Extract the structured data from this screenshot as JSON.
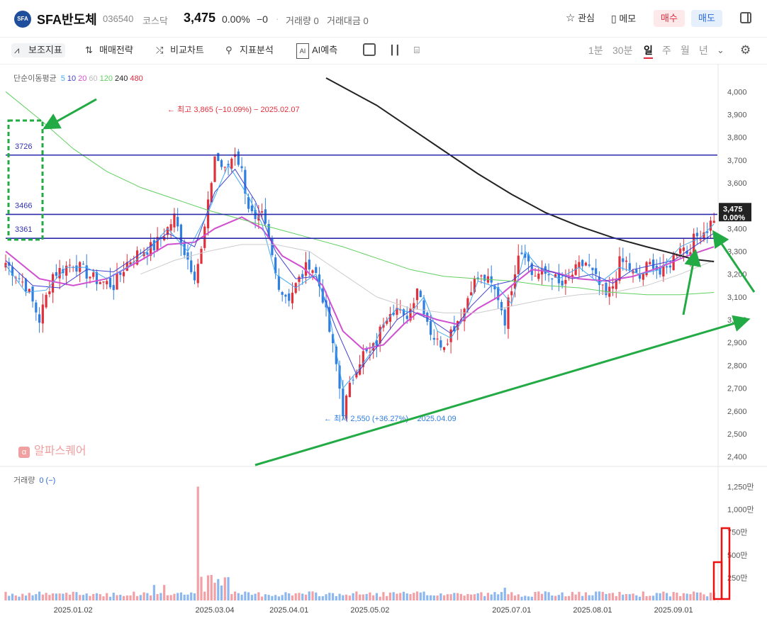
{
  "header": {
    "logo": "SFA",
    "name": "SFA반도체",
    "code": "036540",
    "market": "코스닥",
    "price": "3,475",
    "change_pct": "0.00%",
    "change": "−0",
    "volume": "거래량 0",
    "amount": "거래대금 0",
    "watch_label": "관심",
    "memo_label": "메모",
    "buy_label": "매수",
    "sell_label": "매도"
  },
  "toolbar": {
    "indicators": "보조지표",
    "strategy": "매매전략",
    "compare": "비교차트",
    "analysis": "지표분석",
    "ai": "AI예측",
    "timeframes": [
      "1분",
      "30분",
      "일",
      "주",
      "월",
      "년"
    ],
    "active_timeframe": "일"
  },
  "legend": {
    "ma_title": "단순이동평균",
    "ma_periods": [
      {
        "label": "5",
        "color": "#3fa9f5"
      },
      {
        "label": "10",
        "color": "#4040d0"
      },
      {
        "label": "20",
        "color": "#d050d0"
      },
      {
        "label": "60",
        "color": "#bbbbbb"
      },
      {
        "label": "120",
        "color": "#60d060"
      },
      {
        "label": "240",
        "color": "#222222"
      },
      {
        "label": "480",
        "color": "#e02b3f"
      }
    ],
    "volume_title": "거래량",
    "volume_value": "0 (−)"
  },
  "watermark": "알파스퀘어",
  "chart_data": {
    "type": "candlestick",
    "price_axis": {
      "ticks": [
        "4,000",
        "3,900",
        "3,800",
        "3,700",
        "3,600",
        "3,500",
        "3,400",
        "3,300",
        "3,200",
        "3,100",
        "3,000",
        "2,900",
        "2,800",
        "2,700",
        "2,600",
        "2,500",
        "2,400"
      ],
      "range": [
        2360,
        4060
      ]
    },
    "volume_axis": {
      "ticks": [
        "1,250만",
        "1,000만",
        "750만",
        "500만",
        "250만"
      ],
      "range": [
        0,
        1300
      ]
    },
    "date_ticks": [
      "2025.01.02",
      "2025.03.04",
      "2025.04.01",
      "2025.05.02",
      "2025.07.01",
      "2025.08.01",
      "2025.09.01"
    ],
    "current_price_label": "3,475",
    "current_change_label": "0.00%",
    "high_annotation": "최고 3,865 (−10.09%) − 2025.02.07",
    "low_annotation": "최저 2,550 (+36.27%) − 2025.04.09",
    "horizontal_lines": [
      {
        "label": "3726",
        "value": 3722
      },
      {
        "label": "3466",
        "value": 3462
      },
      {
        "label": "3361",
        "value": 3357
      }
    ],
    "price_path": [
      [
        0,
        3250
      ],
      [
        6,
        3150
      ],
      [
        10,
        3000
      ],
      [
        14,
        3200
      ],
      [
        20,
        3250
      ],
      [
        26,
        3180
      ],
      [
        32,
        3150
      ],
      [
        36,
        3250
      ],
      [
        40,
        3300
      ],
      [
        44,
        3320
      ],
      [
        48,
        3400
      ],
      [
        50,
        3450
      ],
      [
        53,
        3300
      ],
      [
        56,
        3200
      ],
      [
        58,
        3300
      ],
      [
        60,
        3500
      ],
      [
        62,
        3720
      ],
      [
        65,
        3650
      ],
      [
        68,
        3740
      ],
      [
        70,
        3650
      ],
      [
        72,
        3500
      ],
      [
        74,
        3420
      ],
      [
        76,
        3450
      ],
      [
        78,
        3350
      ],
      [
        80,
        3200
      ],
      [
        82,
        3120
      ],
      [
        84,
        3100
      ],
      [
        86,
        3150
      ],
      [
        88,
        3200
      ],
      [
        90,
        3250
      ],
      [
        92,
        3200
      ],
      [
        94,
        3100
      ],
      [
        96,
        2950
      ],
      [
        98,
        2800
      ],
      [
        100,
        2600
      ],
      [
        102,
        2700
      ],
      [
        104,
        2800
      ],
      [
        106,
        2850
      ],
      [
        108,
        2850
      ],
      [
        110,
        2900
      ],
      [
        112,
        3000
      ],
      [
        114,
        3050
      ],
      [
        116,
        3050
      ],
      [
        118,
        3000
      ],
      [
        120,
        3050
      ],
      [
        122,
        3150
      ],
      [
        124,
        3050
      ],
      [
        126,
        2950
      ],
      [
        128,
        2900
      ],
      [
        130,
        2900
      ],
      [
        132,
        2950
      ],
      [
        134,
        3000
      ],
      [
        136,
        3050
      ],
      [
        138,
        3150
      ],
      [
        140,
        3180
      ],
      [
        142,
        3180
      ],
      [
        144,
        3150
      ],
      [
        146,
        3100
      ],
      [
        148,
        3000
      ],
      [
        150,
        3150
      ],
      [
        152,
        3300
      ],
      [
        154,
        3300
      ],
      [
        156,
        3200
      ],
      [
        158,
        3200
      ],
      [
        160,
        3200
      ],
      [
        162,
        3200
      ],
      [
        164,
        3150
      ],
      [
        166,
        3150
      ],
      [
        168,
        3200
      ],
      [
        170,
        3230
      ],
      [
        172,
        3250
      ],
      [
        174,
        3200
      ],
      [
        176,
        3150
      ],
      [
        178,
        3100
      ],
      [
        180,
        3150
      ],
      [
        182,
        3250
      ],
      [
        184,
        3250
      ],
      [
        186,
        3200
      ],
      [
        188,
        3180
      ],
      [
        190,
        3230
      ],
      [
        192,
        3250
      ],
      [
        194,
        3200
      ],
      [
        196,
        3220
      ],
      [
        198,
        3280
      ],
      [
        200,
        3330
      ],
      [
        202,
        3300
      ],
      [
        204,
        3350
      ],
      [
        206,
        3380
      ],
      [
        208,
        3400
      ],
      [
        210,
        3450
      ]
    ],
    "ma_lines": [
      {
        "period": "20",
        "color": "#d050d0",
        "width": 2,
        "points": [
          [
            0,
            3300
          ],
          [
            10,
            3180
          ],
          [
            20,
            3150
          ],
          [
            30,
            3180
          ],
          [
            40,
            3260
          ],
          [
            48,
            3330
          ],
          [
            56,
            3340
          ],
          [
            62,
            3400
          ],
          [
            70,
            3450
          ],
          [
            76,
            3400
          ],
          [
            82,
            3280
          ],
          [
            88,
            3230
          ],
          [
            94,
            3150
          ],
          [
            100,
            2950
          ],
          [
            106,
            2870
          ],
          [
            112,
            2890
          ],
          [
            118,
            2980
          ],
          [
            122,
            3030
          ],
          [
            128,
            3000
          ],
          [
            134,
            2980
          ],
          [
            140,
            3050
          ],
          [
            146,
            3100
          ],
          [
            150,
            3150
          ],
          [
            156,
            3220
          ],
          [
            162,
            3210
          ],
          [
            170,
            3180
          ],
          [
            178,
            3170
          ],
          [
            186,
            3190
          ],
          [
            194,
            3230
          ],
          [
            202,
            3280
          ],
          [
            210,
            3320
          ]
        ]
      },
      {
        "period": "10",
        "color": "#4040d0",
        "width": 1,
        "points": [
          [
            0,
            3260
          ],
          [
            8,
            3150
          ],
          [
            16,
            3140
          ],
          [
            24,
            3220
          ],
          [
            32,
            3210
          ],
          [
            40,
            3290
          ],
          [
            48,
            3380
          ],
          [
            56,
            3320
          ],
          [
            62,
            3560
          ],
          [
            68,
            3660
          ],
          [
            74,
            3520
          ],
          [
            80,
            3300
          ],
          [
            86,
            3180
          ],
          [
            92,
            3190
          ],
          [
            98,
            2960
          ],
          [
            104,
            2760
          ],
          [
            110,
            2880
          ],
          [
            116,
            3000
          ],
          [
            120,
            3040
          ],
          [
            126,
            3000
          ],
          [
            132,
            2940
          ],
          [
            138,
            3060
          ],
          [
            144,
            3150
          ],
          [
            150,
            3170
          ],
          [
            156,
            3240
          ],
          [
            162,
            3210
          ],
          [
            168,
            3180
          ],
          [
            174,
            3200
          ],
          [
            180,
            3160
          ],
          [
            186,
            3220
          ],
          [
            192,
            3240
          ],
          [
            198,
            3260
          ],
          [
            204,
            3320
          ],
          [
            210,
            3380
          ]
        ]
      },
      {
        "period": "5",
        "color": "#3fa9f5",
        "width": 1,
        "points": [
          [
            0,
            3240
          ],
          [
            6,
            3120
          ],
          [
            12,
            3130
          ],
          [
            18,
            3230
          ],
          [
            24,
            3230
          ],
          [
            30,
            3180
          ],
          [
            36,
            3230
          ],
          [
            42,
            3300
          ],
          [
            48,
            3400
          ],
          [
            54,
            3300
          ],
          [
            60,
            3470
          ],
          [
            66,
            3680
          ],
          [
            72,
            3540
          ],
          [
            76,
            3420
          ],
          [
            80,
            3200
          ],
          [
            86,
            3140
          ],
          [
            92,
            3200
          ],
          [
            96,
            3020
          ],
          [
            100,
            2700
          ],
          [
            104,
            2770
          ],
          [
            108,
            2850
          ],
          [
            112,
            2980
          ],
          [
            116,
            3050
          ],
          [
            120,
            3030
          ],
          [
            124,
            3100
          ],
          [
            128,
            2950
          ],
          [
            132,
            2920
          ],
          [
            136,
            3010
          ],
          [
            140,
            3170
          ],
          [
            146,
            3140
          ],
          [
            150,
            3070
          ],
          [
            154,
            3300
          ],
          [
            158,
            3230
          ],
          [
            164,
            3180
          ],
          [
            170,
            3230
          ],
          [
            176,
            3160
          ],
          [
            182,
            3230
          ],
          [
            188,
            3200
          ],
          [
            194,
            3220
          ],
          [
            200,
            3320
          ],
          [
            206,
            3360
          ],
          [
            210,
            3420
          ]
        ]
      },
      {
        "period": "60",
        "color": "#cccccc",
        "width": 1,
        "points": [
          [
            40,
            3200
          ],
          [
            50,
            3260
          ],
          [
            60,
            3300
          ],
          [
            70,
            3330
          ],
          [
            80,
            3330
          ],
          [
            90,
            3300
          ],
          [
            100,
            3200
          ],
          [
            110,
            3100
          ],
          [
            120,
            3050
          ],
          [
            130,
            3030
          ],
          [
            140,
            3030
          ],
          [
            150,
            3060
          ],
          [
            160,
            3090
          ],
          [
            170,
            3110
          ],
          [
            180,
            3120
          ],
          [
            190,
            3150
          ],
          [
            200,
            3200
          ],
          [
            210,
            3260
          ]
        ]
      },
      {
        "period": "120",
        "color": "#60d060",
        "width": 1,
        "points": [
          [
            0,
            4000
          ],
          [
            10,
            3880
          ],
          [
            20,
            3750
          ],
          [
            30,
            3650
          ],
          [
            40,
            3580
          ],
          [
            50,
            3530
          ],
          [
            60,
            3480
          ],
          [
            70,
            3440
          ],
          [
            80,
            3400
          ],
          [
            90,
            3360
          ],
          [
            100,
            3320
          ],
          [
            110,
            3270
          ],
          [
            120,
            3220
          ],
          [
            130,
            3190
          ],
          [
            140,
            3180
          ],
          [
            150,
            3170
          ],
          [
            160,
            3150
          ],
          [
            170,
            3140
          ],
          [
            180,
            3120
          ],
          [
            190,
            3110
          ],
          [
            200,
            3110
          ],
          [
            210,
            3120
          ]
        ]
      },
      {
        "period": "240",
        "color": "#222222",
        "width": 2,
        "points": [
          [
            95,
            4060
          ],
          [
            110,
            3940
          ],
          [
            120,
            3840
          ],
          [
            130,
            3740
          ],
          [
            140,
            3640
          ],
          [
            150,
            3550
          ],
          [
            160,
            3470
          ],
          [
            170,
            3410
          ],
          [
            180,
            3360
          ],
          [
            190,
            3320
          ],
          [
            198,
            3290
          ],
          [
            204,
            3265
          ],
          [
            210,
            3255
          ]
        ]
      }
    ],
    "annotations": {
      "dashed_box": "green",
      "arrows": "green",
      "trendline": "green rising",
      "volume_highlight_boxes": "red"
    }
  }
}
